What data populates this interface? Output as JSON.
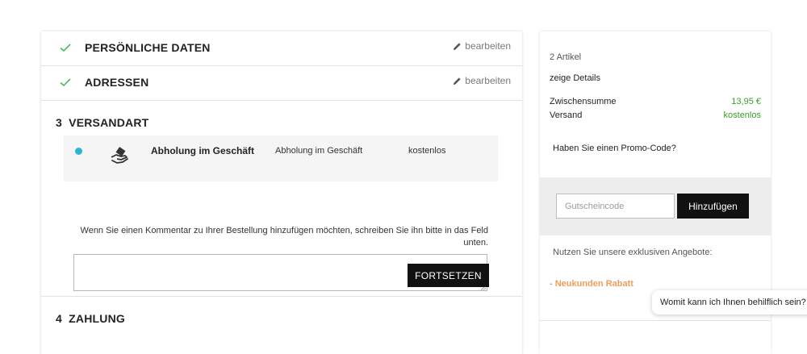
{
  "checkout": {
    "steps_done": [
      {
        "title": "PERSÖNLICHE DATEN",
        "edit_label": "bearbeiten"
      },
      {
        "title": "ADRESSEN",
        "edit_label": "bearbeiten"
      }
    ],
    "current_step": {
      "number_title": "3  VERSANDART",
      "option": {
        "name": "Abholung im Geschäft",
        "delay": "Abholung im Geschäft",
        "price": "kostenlos"
      },
      "comment_label": "Wenn Sie einen Kommentar zu Ihrer Bestellung hinzufügen möchten, schreiben Sie ihn bitte in das Feld unten.",
      "comment_value": "",
      "continue_label": "FORTSETZEN"
    },
    "next_step": {
      "title": "4  ZAHLUNG"
    }
  },
  "summary": {
    "item_count": "2 Artikel",
    "details_label": "zeige Details",
    "subtotal_label": "Zwischensumme",
    "subtotal_value": "13,95 €",
    "shipping_label": "Versand",
    "shipping_value": "kostenlos",
    "promo_question": "Haben Sie einen Promo-Code?",
    "promo_placeholder": "Gutscheincode",
    "promo_button": "Hinzufügen",
    "offers_label": "Nutzen Sie unsere exklusiven Angebote:",
    "offer_link": "- Neukunden Rabatt"
  },
  "chat": {
    "text": "Womit kann ich Ihnen behilflich sein?"
  },
  "colors": {
    "check": "#4cbb6c",
    "radio": "#2fb5d2",
    "accent_green": "#3b9b2a",
    "offer_orange": "#f39d5a"
  },
  "icons": {
    "check": "check-icon",
    "edit": "pencil-icon",
    "carrier": "hand-package-icon"
  }
}
